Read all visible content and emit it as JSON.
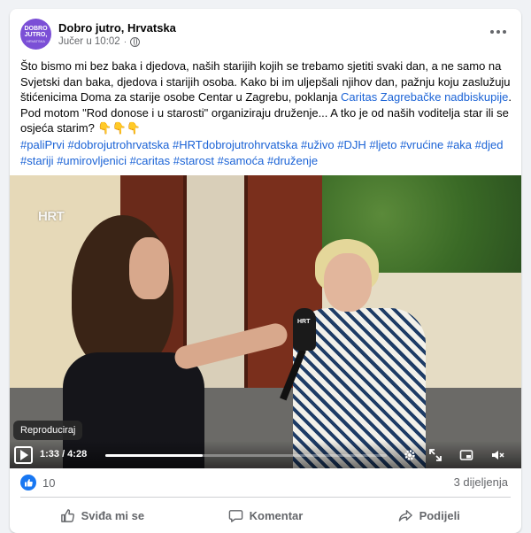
{
  "post": {
    "page_name": "Dobro jutro, Hrvatska",
    "timestamp": "Jučer u 10:02",
    "meta_separator": "·",
    "avatar_text": "DOBRO JUTRO,",
    "avatar_sub": "HRVATSKA",
    "text_part1": "Što bismo mi bez baka i djedova, naših starijih kojih se trebamo sjetiti svaki dan, a ne samo na Svjetski dan baka, djedova i starijih osoba. Kako bi im uljepšali njihov dan, pažnju koju zaslužuju štićenicima Doma za starije osobe Centar u Zagrebu, poklanja ",
    "text_link": "Caritas Zagrebačke nadbiskupije",
    "text_part2": ". Pod motom \"Rod donose i u starosti\" organiziraju druženje... A tko je od naših voditelja star ili se osjeća starim? 👇👇👇",
    "hashtags": [
      "#paliPrvi",
      "#dobrojutrohrvatska",
      "#HRTdobrojutrohrvatska",
      "#uživo",
      "#DJH",
      "#ljeto",
      "#vrućine",
      "#aka",
      "#djed",
      "#stariji",
      "#umirovljenici",
      "#caritas",
      "#starost",
      "#samoća",
      "#druženje"
    ]
  },
  "video": {
    "channel_logo": "HRT",
    "mic_label": "HRT",
    "tooltip": "Reproduciraj",
    "time_display": "1:33 / 4:28",
    "progress_fraction": 0.347
  },
  "engagement": {
    "like_count": "10",
    "shares": "3 dijeljenja"
  },
  "actions": {
    "like": "Sviđa mi se",
    "comment": "Komentar",
    "share": "Podijeli"
  },
  "colors": {
    "accent": "#1877f2",
    "link": "#1b63d6",
    "muted": "#65676b"
  }
}
